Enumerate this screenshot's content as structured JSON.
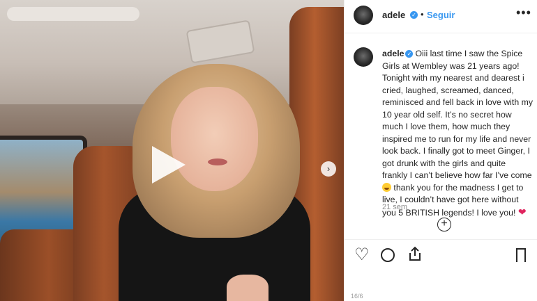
{
  "post": {
    "username": "adele",
    "verified_icon": "verified-badge-icon",
    "separator": "•",
    "follow_label": "Seguir",
    "more_icon": "more-options-icon",
    "more_glyph": "•••"
  },
  "caption": {
    "username": "adele",
    "text_1": "Oiii last time I saw the Spice Girls at Wembley was 21 years ago! Tonight with my nearest and dearest i cried, laughed, screamed, danced, reminisced and fell back in love with my 10 year old self. It’s no secret how much I love them, how much they inspired me to run for my life and never look back. I finally got to meet Ginger, I got drunk with the girls and quite frankly I can’t believe how far I’ve come",
    "emoji_1": "laughing-emoji",
    "text_2": " thank you for the madness I get to live, I couldn’t have got here without you 5 BRITISH legends! I love you! ",
    "emoji_2_glyph": "❤",
    "time": "21 sem"
  },
  "media": {
    "play_icon": "play-icon",
    "next_icon": "next-chevron-icon",
    "next_glyph": "›"
  },
  "actions": {
    "like_glyph": "♡",
    "add_comment_glyph": "+"
  },
  "counter": "16/6",
  "colors": {
    "accent": "#3897f0",
    "heart": "#e0245e",
    "muted": "#8e8e8e"
  }
}
